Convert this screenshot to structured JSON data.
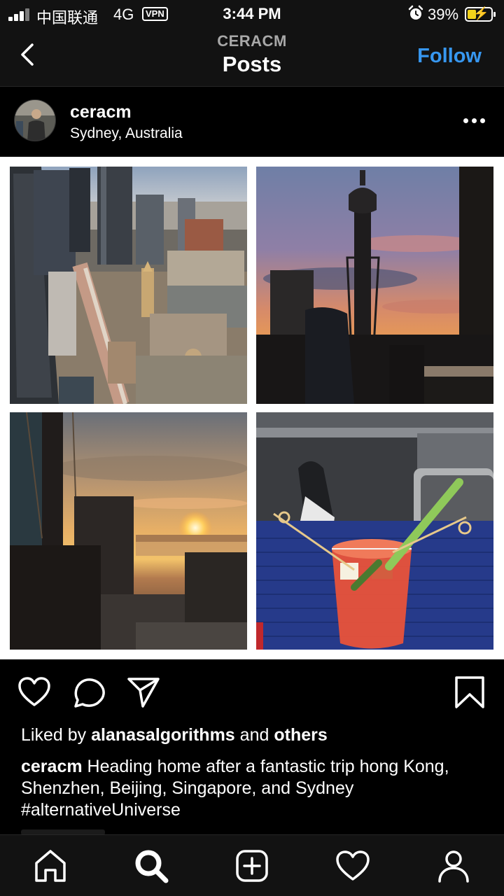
{
  "status_bar": {
    "carrier": "中国联通",
    "network": "4G",
    "vpn": "VPN",
    "time": "3:44 PM",
    "battery_percent": "39%",
    "battery_level": 0.39,
    "icons": [
      "signal-icon",
      "alarm-icon",
      "battery-charging-icon"
    ]
  },
  "header": {
    "subtitle": "CERACM",
    "title": "Posts",
    "follow_label": "Follow",
    "accent_color": "#3797f0"
  },
  "post": {
    "username": "ceracm",
    "location": "Sydney, Australia",
    "likes_prefix": "Liked by",
    "likes_user": "alanasalgorithms",
    "likes_and": "and",
    "likes_others": "others",
    "caption_user": "ceracm",
    "caption_text": "Heading home after a fantastic trip hong Kong, Shenzhen, Beijing, Singapore, and Sydney",
    "hashtag": "#alternativeUniverse",
    "photos": [
      {
        "name": "aerial-city-photo",
        "description": "city skyline from above"
      },
      {
        "name": "tower-sunset-photo",
        "description": "tower at sunset"
      },
      {
        "name": "harbour-sunset-photo",
        "description": "harbour sunset"
      },
      {
        "name": "drink-photo",
        "description": "drink on plane"
      }
    ]
  },
  "actions": [
    "heart-icon",
    "comment-icon",
    "share-icon",
    "bookmark-icon"
  ],
  "bottom_nav": [
    "home-icon",
    "search-icon",
    "new-post-icon",
    "activity-icon",
    "profile-icon"
  ]
}
